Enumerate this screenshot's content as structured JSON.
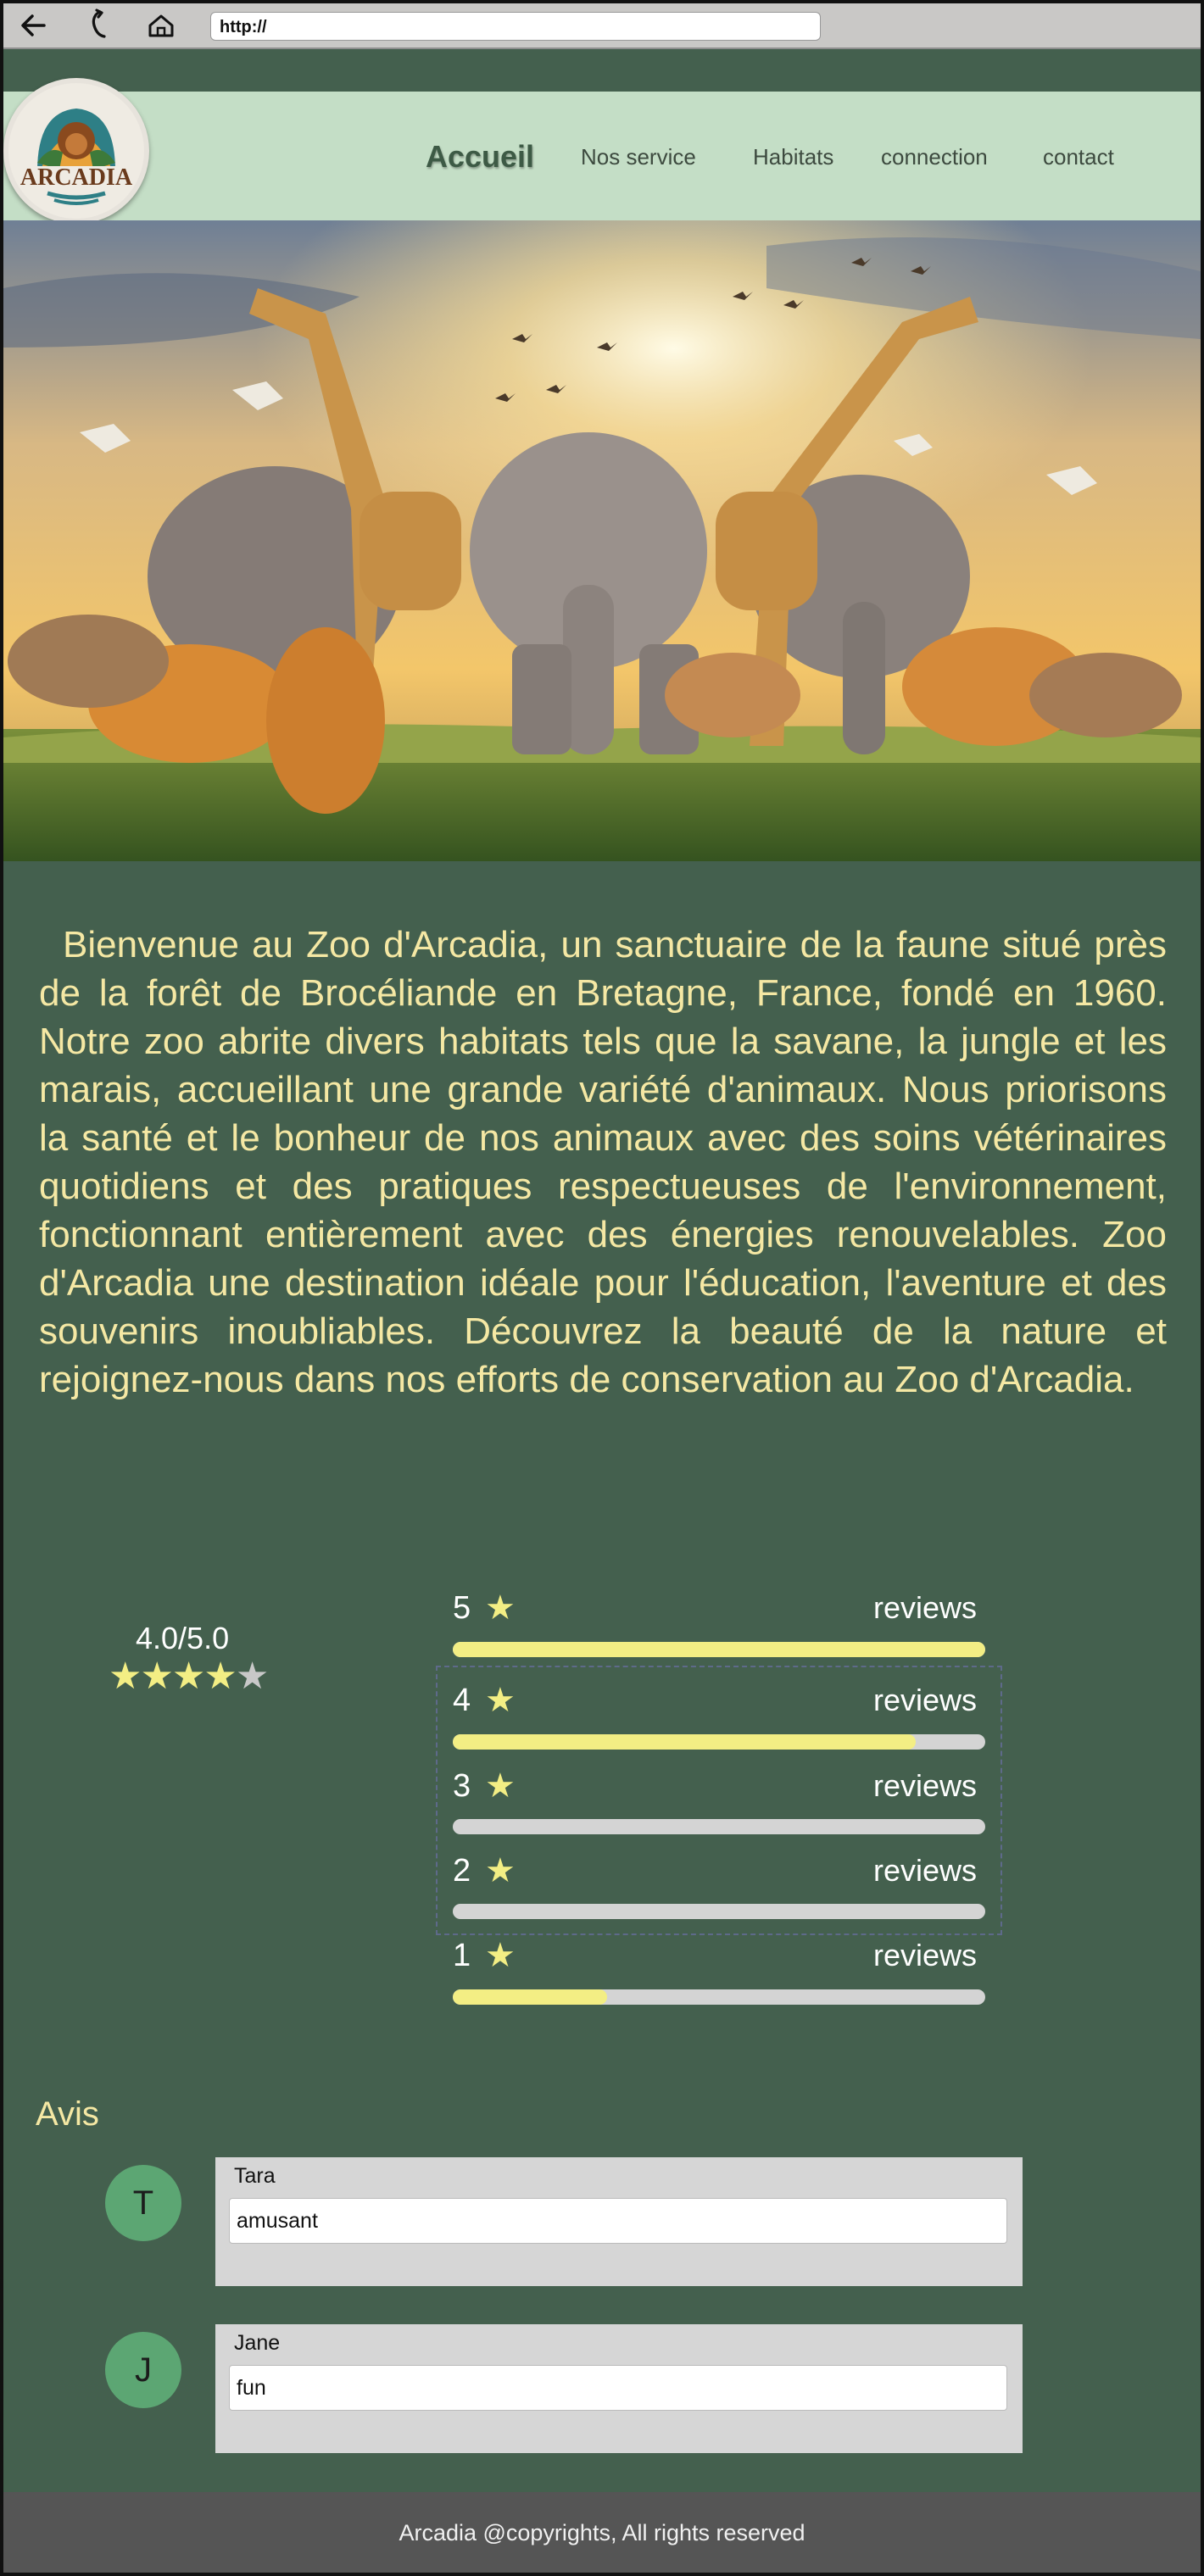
{
  "browser": {
    "url": "http://"
  },
  "nav": {
    "logo_text": "ARCADIA",
    "items": [
      {
        "label": "Accueil",
        "active": true
      },
      {
        "label": "Nos service",
        "active": false
      },
      {
        "label": "Habitats",
        "active": false
      },
      {
        "label": "connection",
        "active": false
      },
      {
        "label": "contact",
        "active": false
      }
    ]
  },
  "intro": {
    "text": "Bienvenue au Zoo d'Arcadia, un sanctuaire de la faune situé près de la forêt de Brocéliande en Bretagne, France, fondé en 1960. Notre zoo abrite divers habitats tels que la savane, la jungle et les marais, accueillant une grande variété d'animaux. Nous priorisons la santé et le bonheur de nos animaux avec des soins vétérinaires quotidiens et des pratiques respectueuses de l'environnement, fonctionnant entièrement avec des énergies renouvelables. Zoo d'Arcadia une destination idéale pour l'éducation, l'aventure et des souvenirs inoubliables. Découvrez la beauté de la nature et rejoignez-nous dans nos efforts de conservation au Zoo d'Arcadia."
  },
  "rating": {
    "average": "4.0/5.0",
    "stars_filled": 4,
    "stars_total": 5,
    "rows": [
      {
        "label": "5",
        "text": "reviews",
        "fraction": 1.0
      },
      {
        "label": "4",
        "text": "reviews",
        "fraction": 0.87
      },
      {
        "label": "3",
        "text": "reviews",
        "fraction": 0
      },
      {
        "label": "2",
        "text": "reviews",
        "fraction": 0
      },
      {
        "label": "1",
        "text": "reviews",
        "fraction": 0.29
      }
    ]
  },
  "reviews": {
    "title": "Avis",
    "items": [
      {
        "initial": "T",
        "name": "Tara",
        "text": "amusant"
      },
      {
        "initial": "J",
        "name": "Jane",
        "text": "fun"
      }
    ]
  },
  "footer": {
    "text": "Arcadia @copyrights, All rights reserved"
  },
  "colors": {
    "page_bg": "#44604e",
    "nav_bg": "#c4dec6",
    "accent_yellow": "#f3ee84",
    "intro_text": "#f5e8a4",
    "avatar": "#5ca673",
    "footer_bg": "#555555"
  }
}
